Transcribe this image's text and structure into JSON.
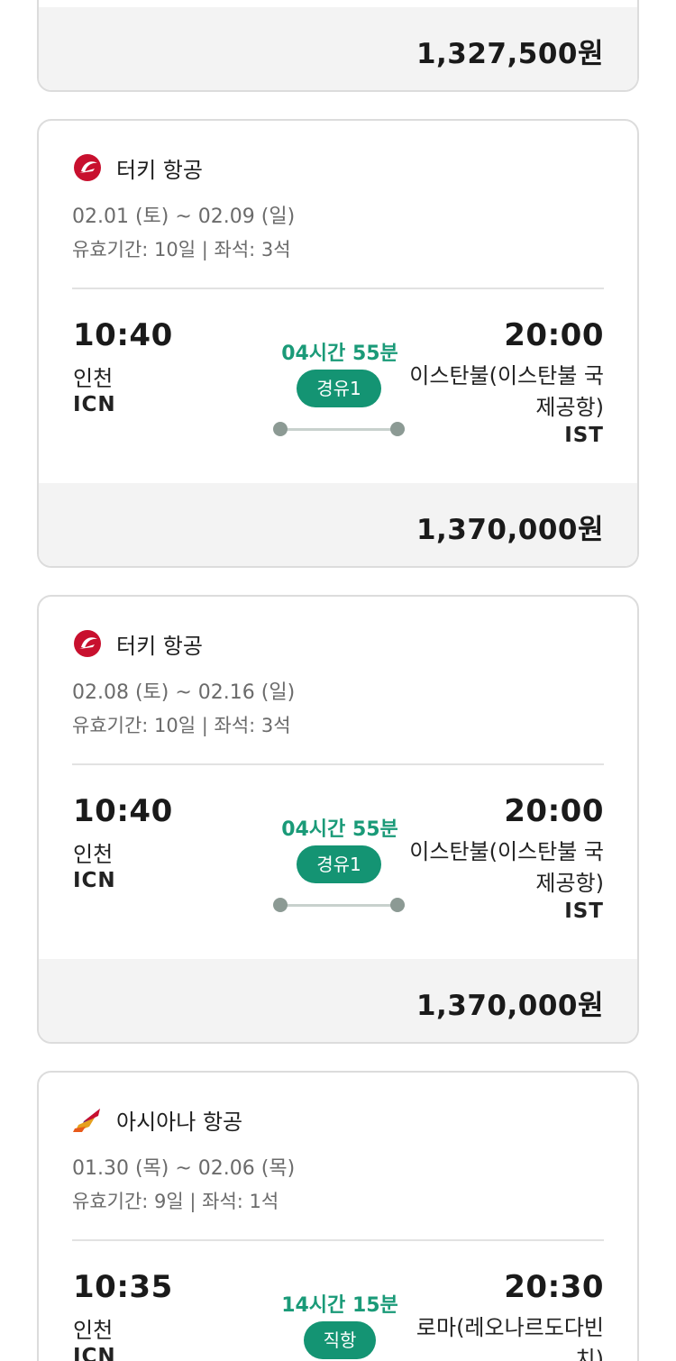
{
  "cards": [
    {
      "price": "1,327,500원"
    },
    {
      "airline": "터키 항공",
      "dates": "02.01 (토) ~ 02.09 (일)",
      "validity": "유효기간: 10일 | 좌석: 3석",
      "departure": {
        "time": "10:40",
        "city": "인천",
        "code": "ICN"
      },
      "arrival": {
        "time": "20:00",
        "city": "이스탄불(이스탄불 국제공항)",
        "code": "IST"
      },
      "duration": "04시간 55분",
      "stops": "경유1",
      "price": "1,370,000원"
    },
    {
      "airline": "터키 항공",
      "dates": "02.08 (토) ~ 02.16 (일)",
      "validity": "유효기간: 10일 | 좌석: 3석",
      "departure": {
        "time": "10:40",
        "city": "인천",
        "code": "ICN"
      },
      "arrival": {
        "time": "20:00",
        "city": "이스탄불(이스탄불 국제공항)",
        "code": "IST"
      },
      "duration": "04시간 55분",
      "stops": "경유1",
      "price": "1,370,000원"
    },
    {
      "airline": "아시아나 항공",
      "dates": "01.30 (목) ~ 02.06 (목)",
      "validity": "유효기간: 9일 | 좌석: 1석",
      "departure": {
        "time": "10:35",
        "city": "인천",
        "code": "ICN"
      },
      "arrival": {
        "time": "20:30",
        "city": "로마(레오나르도다빈치)"
      },
      "duration": "14시간 15분",
      "stops": "직항"
    }
  ],
  "colors": {
    "accent_green": "#149473",
    "duration_green": "#1a9a78",
    "turkish_red": "#c8102e"
  },
  "icons": {
    "turkish": "turkish-airlines-logo-icon",
    "asiana": "asiana-airlines-logo-icon"
  }
}
